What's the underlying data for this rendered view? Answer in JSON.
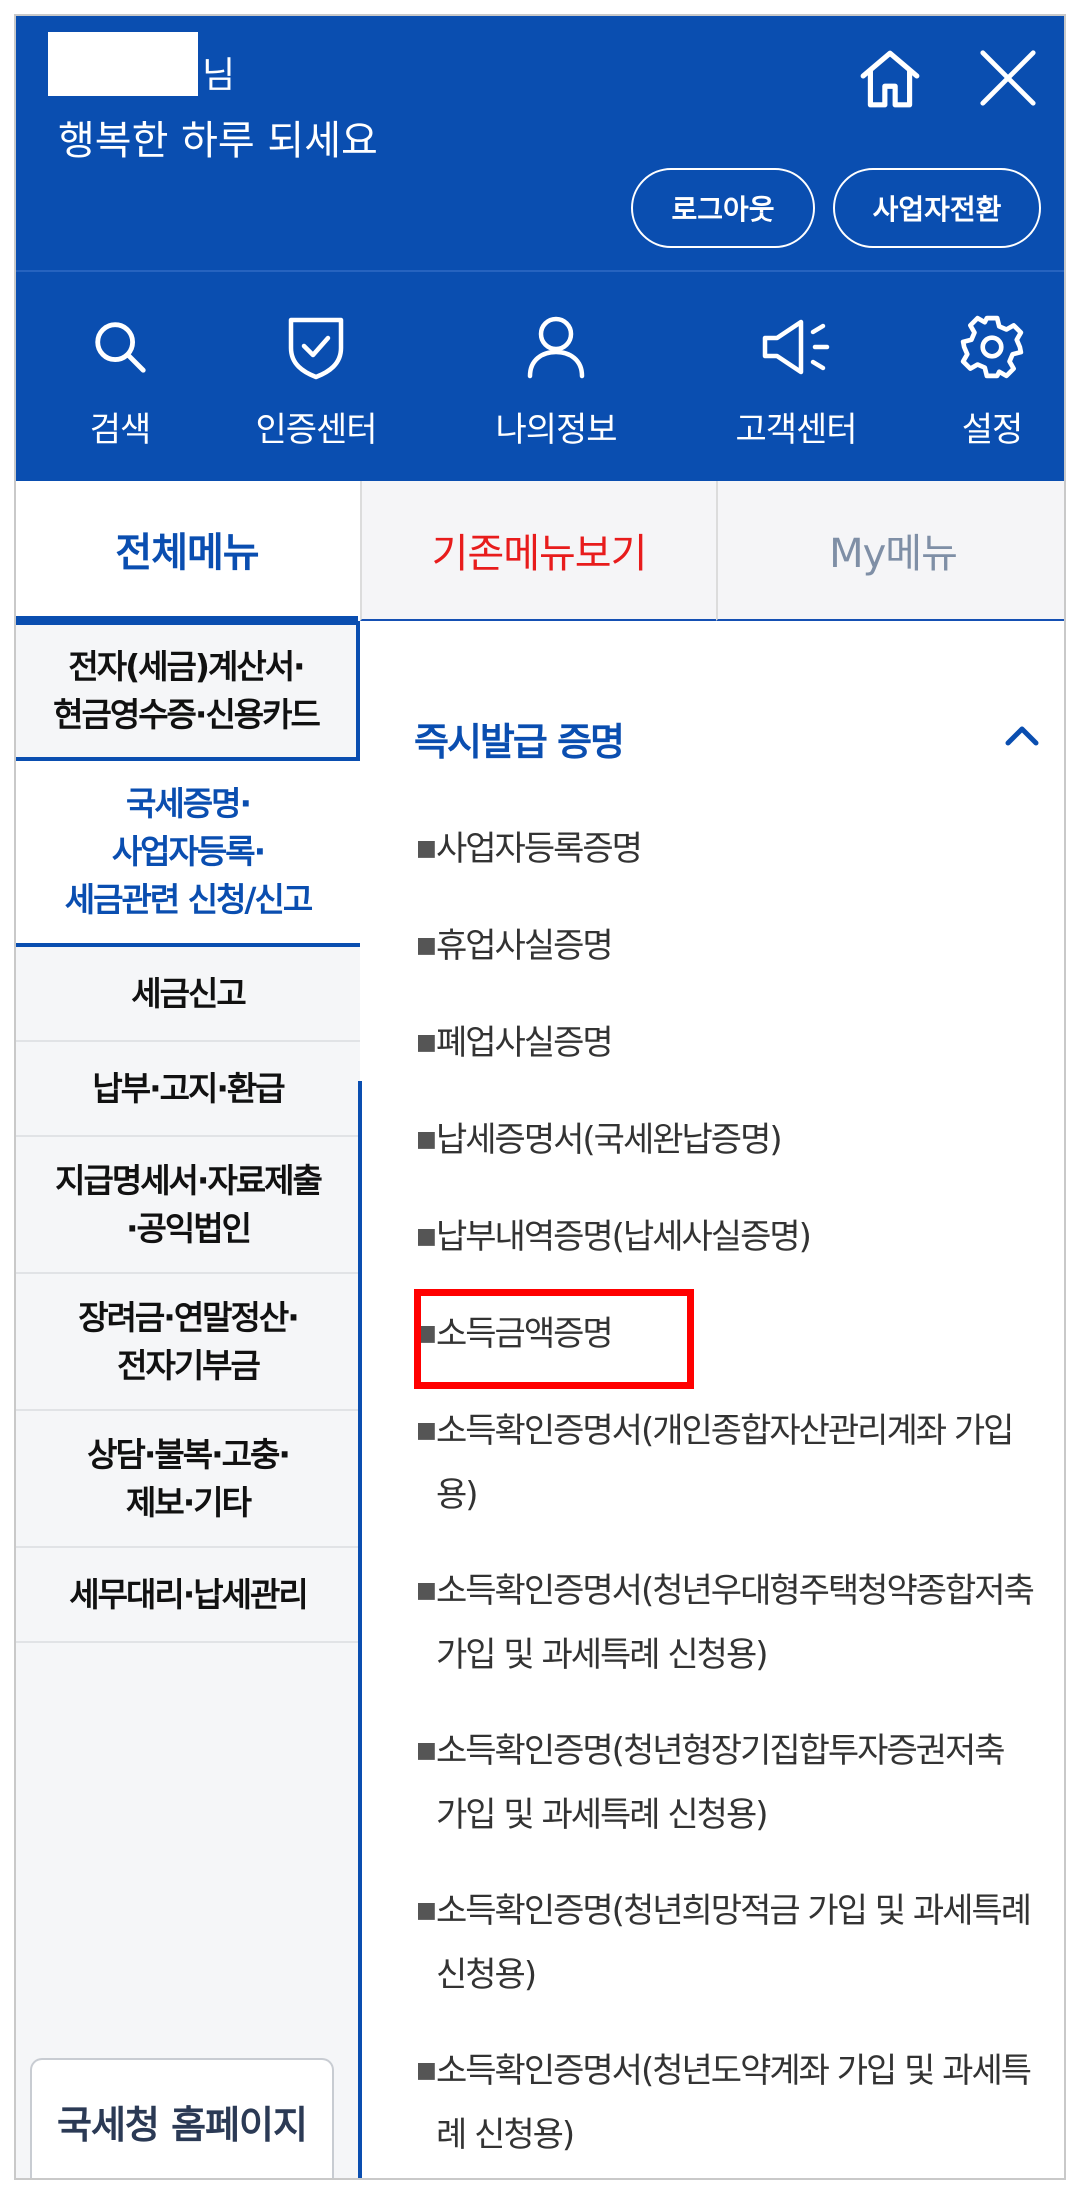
{
  "header": {
    "greeting_suffix": "님",
    "greeting_line2": "행복한 하루 되세요",
    "logout_label": "로그아웃",
    "switch_label": "사업자전환",
    "icons": {
      "home": "home-icon",
      "close": "close-icon"
    }
  },
  "quick": [
    {
      "label": "검색",
      "icon": "search-icon"
    },
    {
      "label": "인증센터",
      "icon": "shield-check-icon"
    },
    {
      "label": "나의정보",
      "icon": "user-icon"
    },
    {
      "label": "고객센터",
      "icon": "megaphone-icon"
    },
    {
      "label": "설정",
      "icon": "gear-icon"
    }
  ],
  "tabs": {
    "all": "전체메뉴",
    "old": "기존메뉴보기",
    "my": "My메뉴"
  },
  "leftnav": {
    "items": [
      {
        "label": "전자(세금)계산서·\n현금영수증·신용카드"
      },
      {
        "label": "국세증명·\n사업자등록·\n세금관련 신청/신고"
      },
      {
        "label": "세금신고"
      },
      {
        "label": "납부·고지·환급"
      },
      {
        "label": "지급명세서·자료제출\n·공익법인"
      },
      {
        "label": "장려금·연말정산·\n전자기부금"
      },
      {
        "label": "상담·불복·고충·\n제보·기타"
      },
      {
        "label": "세무대리·납세관리"
      }
    ],
    "homepage_button": "국세청 홈페이지"
  },
  "content": {
    "section_title": "즉시발급 증명",
    "items": [
      "사업자등록증명",
      "휴업사실증명",
      "폐업사실증명",
      "납세증명서(국세완납증명)",
      "납부내역증명(납세사실증명)",
      "소득금액증명",
      "소득확인증명서(개인종합자산관리계좌 가입용)",
      "소득확인증명서(청년우대형주택청약종합저축 가입 및 과세특례 신청용)",
      "소득확인증명(청년형장기집합투자증권저축 가입 및 과세특례 신청용)",
      "소득확인증명(청년희망적금 가입 및 과세특례 신청용)",
      "소득확인증명서(청년도약계좌 가입 및 과세특례 신청용)"
    ]
  },
  "colors": {
    "brand_blue": "#0a4eb0",
    "red_tab": "#e81c1c",
    "highlight": "#ff0000"
  }
}
